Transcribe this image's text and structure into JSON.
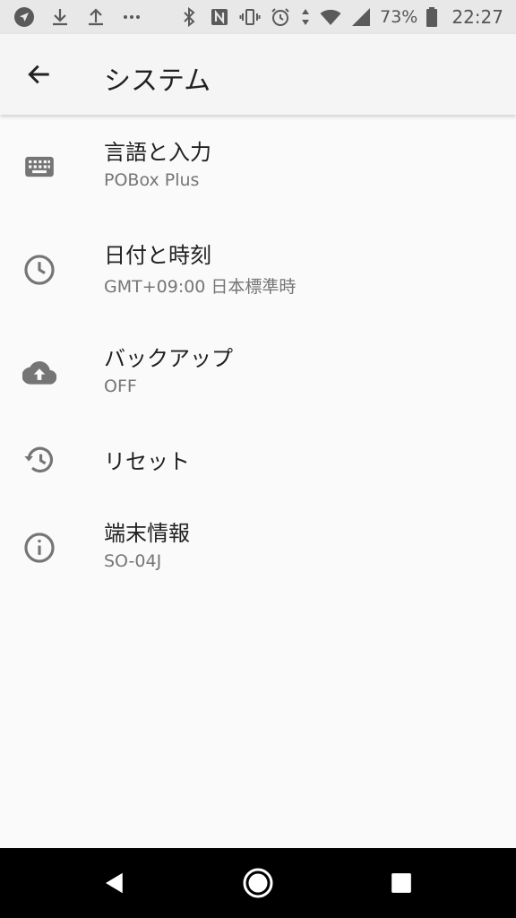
{
  "status_bar": {
    "battery_percent": "73%",
    "time": "22:27",
    "left_icons": [
      "navigation-icon",
      "download-icon",
      "upload-icon",
      "more-icon"
    ],
    "right_icons": [
      "bluetooth-icon",
      "nfc-icon",
      "vibrate-icon",
      "alarm-icon",
      "data-arrows-icon",
      "wifi-icon",
      "signal-icon",
      "battery-icon"
    ]
  },
  "app_bar": {
    "title": "システム",
    "back_icon": "arrow-back-icon"
  },
  "settings": {
    "items": [
      {
        "title": "言語と入力",
        "subtitle": "POBox Plus",
        "icon": "keyboard-icon"
      },
      {
        "title": "日付と時刻",
        "subtitle": "GMT+09:00 日本標準時",
        "icon": "clock-icon"
      },
      {
        "title": "バックアップ",
        "subtitle": "OFF",
        "icon": "cloud-upload-icon"
      },
      {
        "title": "リセット",
        "subtitle": "",
        "icon": "history-icon"
      },
      {
        "title": "端末情報",
        "subtitle": "SO-04J",
        "icon": "info-icon"
      }
    ]
  },
  "nav_bar": {
    "icons": [
      "back-triangle-icon",
      "home-circle-icon",
      "recents-square-icon"
    ]
  },
  "colors": {
    "status_bar_bg": "#e8e8e8",
    "app_bar_bg": "#f5f5f5",
    "background": "#fafafa",
    "title_text": "#212121",
    "subtitle_text": "#757575",
    "icon": "#757575",
    "nav_bar_bg": "#000000"
  }
}
